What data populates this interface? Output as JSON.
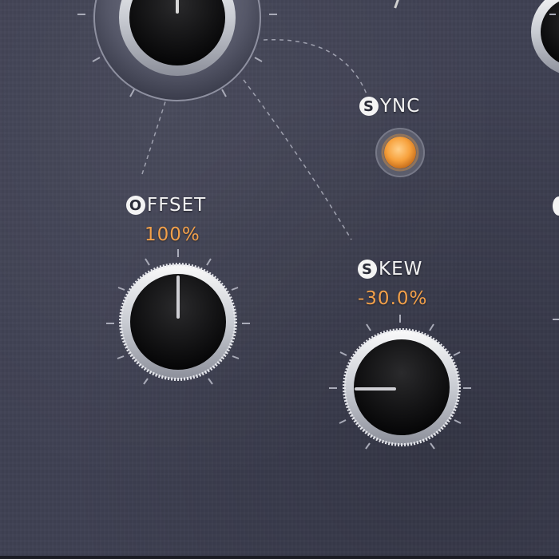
{
  "controls": {
    "sync": {
      "cap": "S",
      "rest": "YNC",
      "active": true,
      "led_color": "#f7a13c"
    },
    "offset": {
      "cap": "O",
      "rest": "FFSET",
      "value": "100%",
      "knob_angle_deg": 0
    },
    "skew": {
      "cap": "S",
      "rest": "KEW",
      "value": "-30.0%",
      "knob_angle_deg": -90
    }
  },
  "colors": {
    "panel": "#3f4153",
    "value_text": "#f2a04a",
    "label_text": "#f3f3f3"
  }
}
